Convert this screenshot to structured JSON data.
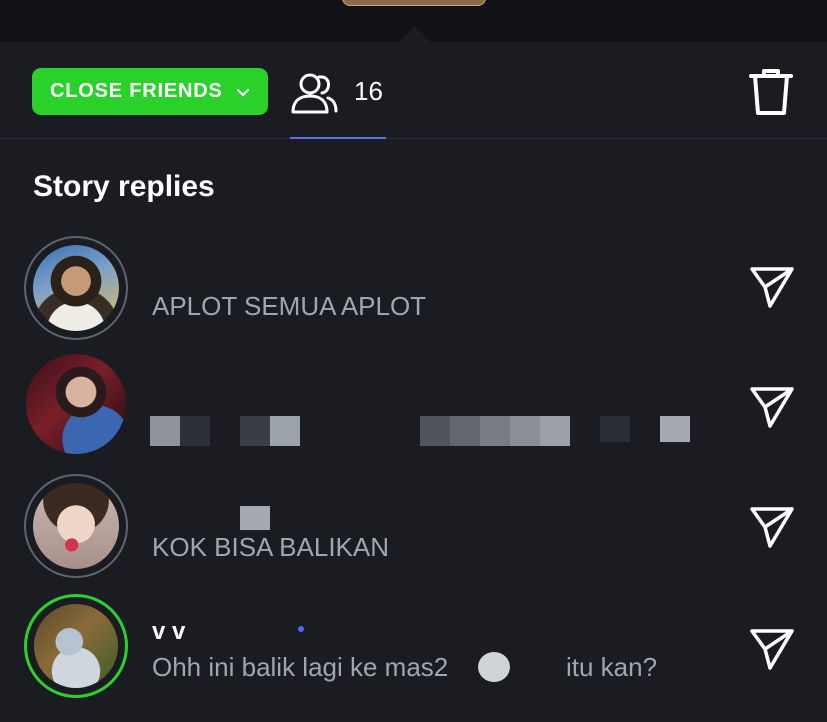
{
  "toolbar": {
    "audience_label": "CLOSE FRIENDS",
    "viewer_count": "16",
    "audience_color": "#2bd12b",
    "accent_underline": "#5b6cff"
  },
  "section": {
    "title": "Story replies"
  },
  "replies": [
    {
      "name": "",
      "message": "APLOT SEMUA APLOT",
      "ring": "gray"
    },
    {
      "name": "",
      "message": "",
      "ring": "none"
    },
    {
      "name": "",
      "message": "KOK BISA BALIKAN",
      "ring": "gray"
    },
    {
      "name": "v   v",
      "message": "Ohh ini balik lagi ke mas2",
      "message_tail": "itu kan?",
      "ring": "green"
    }
  ],
  "icons": {
    "audience_dropdown": "chevron-down-icon",
    "viewers": "people-icon",
    "delete": "trash-icon",
    "send": "send-icon"
  }
}
